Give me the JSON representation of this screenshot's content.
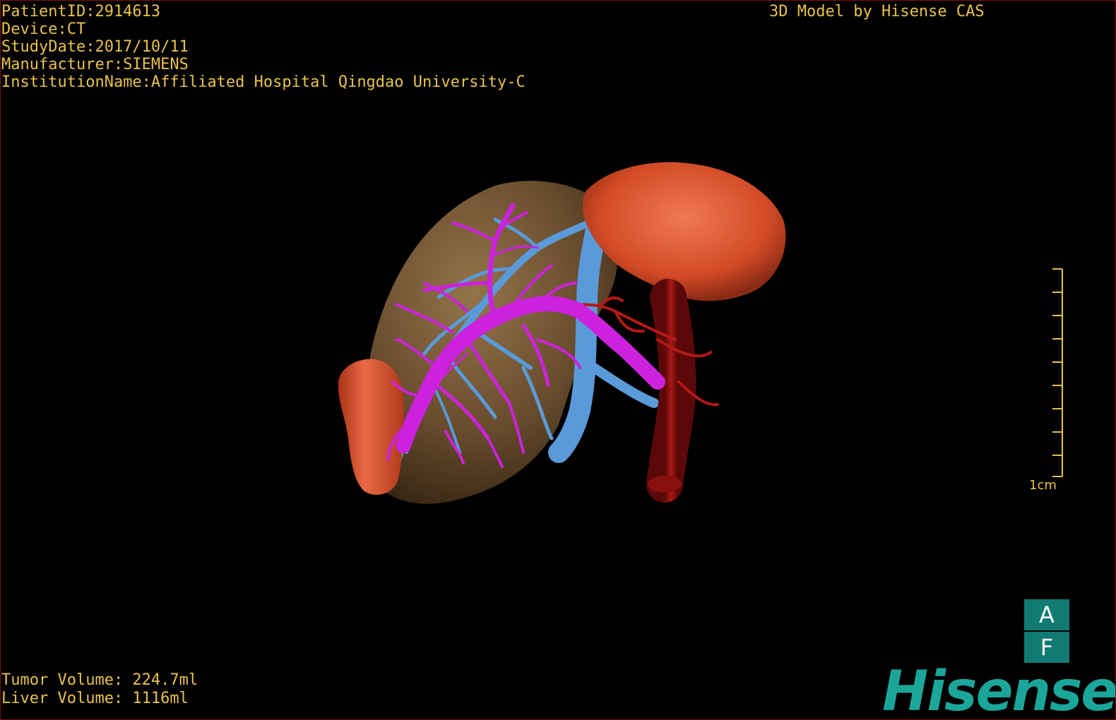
{
  "header": {
    "patient_id": "PatientID:2914613",
    "device": "Device:CT",
    "study_date": "StudyDate:2017/10/11",
    "manufacturer": "Manufacturer:SIEMENS",
    "institution": "InstitutionName:Affiliated Hospital Qingdao University-C",
    "model_credit": "3D Model by Hisense CAS"
  },
  "volumes": {
    "tumor": "Tumor Volume: 224.7ml",
    "liver": "Liver Volume: 1116ml"
  },
  "scale_bar": {
    "label": "1cm"
  },
  "orientation": {
    "top": "A",
    "bottom": "F"
  },
  "brand": {
    "logo_text": "Hisense"
  },
  "colors": {
    "hud_text": "#e8c24a",
    "liver": "#7a5a35",
    "tumor": "#d8502c",
    "portal_vein": "#cc22dd",
    "hepatic_vein": "#5a9ad8",
    "artery": "#9a1010",
    "brand": "#1aa79a",
    "orientation_box": "#117a72"
  }
}
